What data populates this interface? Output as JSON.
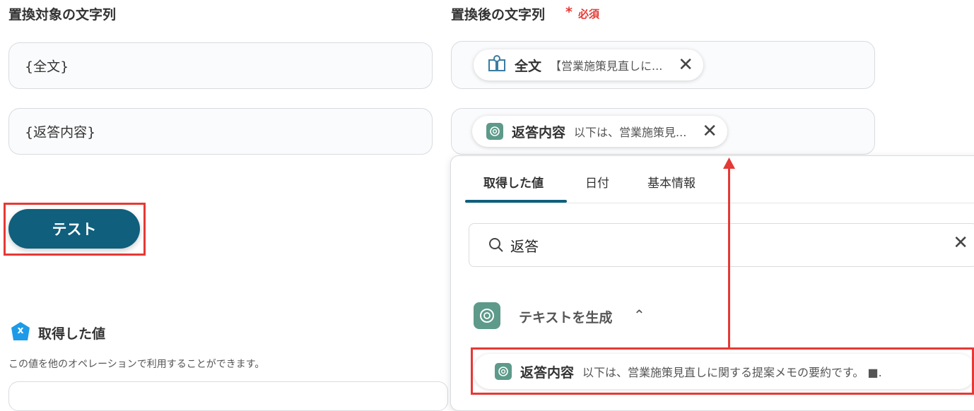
{
  "left_column": {
    "label": "置換対象の文字列",
    "fields": [
      {
        "value": "{全文}"
      },
      {
        "value": "{返答内容}"
      }
    ],
    "test_button": "テスト",
    "obtained_section": {
      "title": "取得した値",
      "badge": "x",
      "description": "この値を他のオペレーションで利用することができます。"
    }
  },
  "right_column": {
    "label": "置換後の文字列",
    "required_mark": "*",
    "required_text": "必須",
    "chips": [
      {
        "title": "全文",
        "value": "【営業施策見直しに...",
        "icon": "book-icon"
      },
      {
        "title": "返答内容",
        "value": "以下は、営業施策見...",
        "icon": "chatgpt-icon"
      }
    ]
  },
  "dropdown": {
    "tabs": [
      "取得した値",
      "日付",
      "基本情報"
    ],
    "active_tab": 0,
    "search": {
      "value": "返答"
    },
    "group": {
      "title": "テキストを生成",
      "icon": "chatgpt-icon",
      "expanded": true
    },
    "result": {
      "title": "返答内容",
      "value": "以下は、営業施策見直しに関する提案メモの要約です。 ■."
    }
  },
  "colors": {
    "primary": "#0f5f7d",
    "highlight": "#e53935",
    "gpt_green": "#5d9a8a",
    "badge_blue": "#1e9be8"
  }
}
